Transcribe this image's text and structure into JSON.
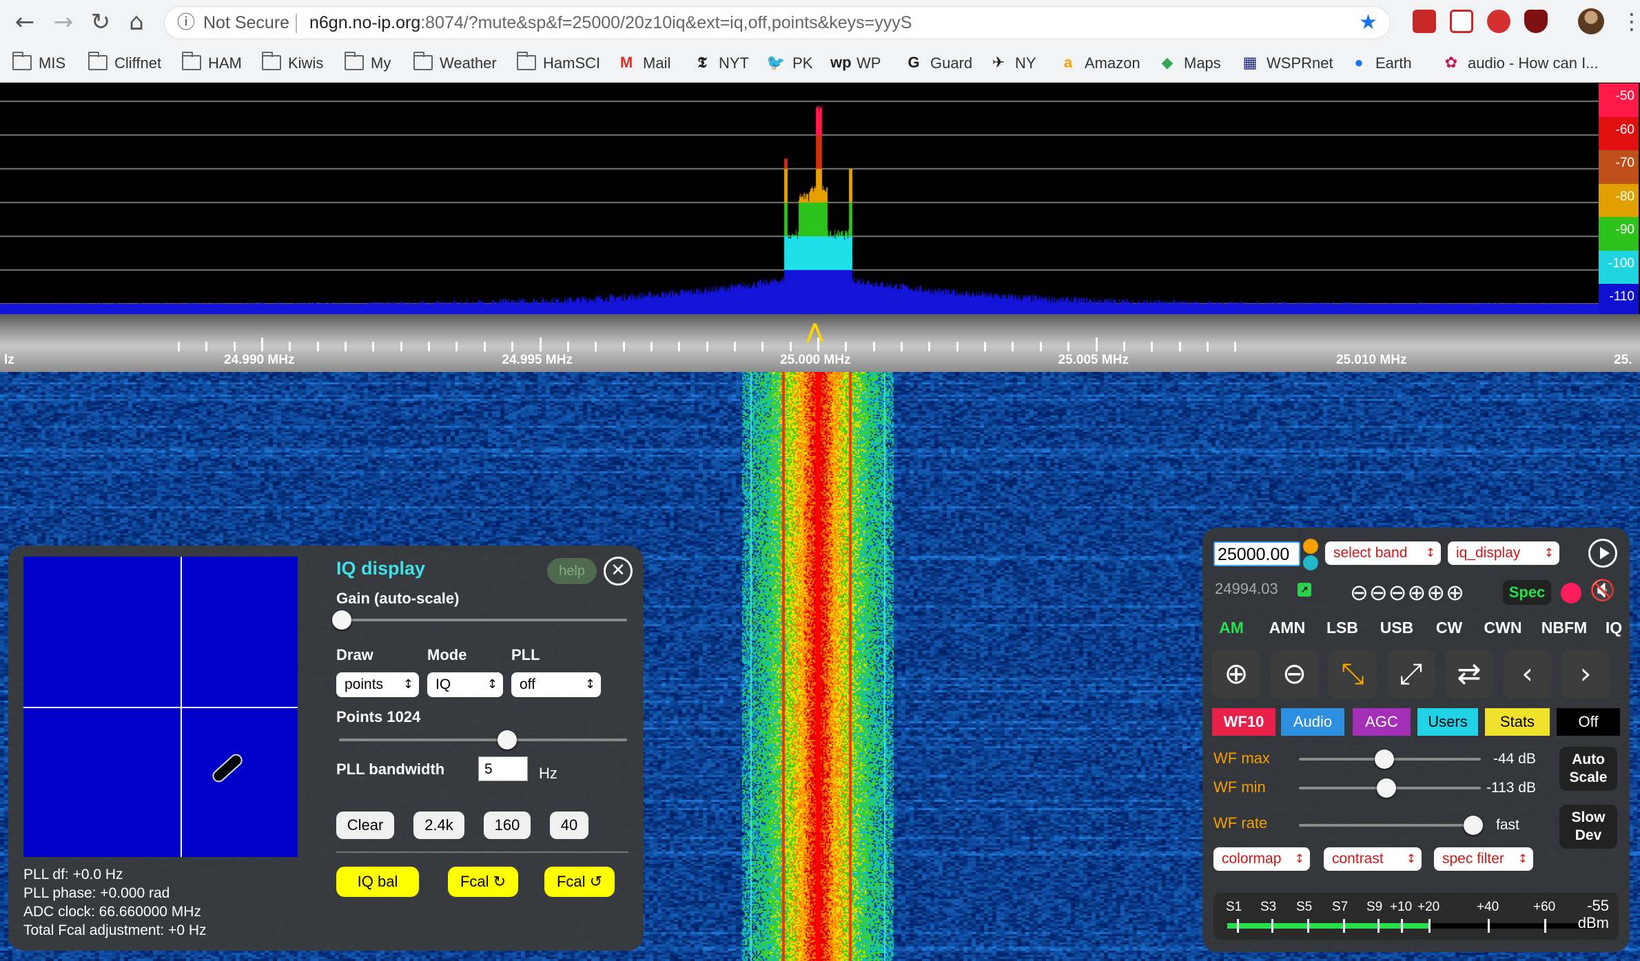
{
  "browser": {
    "back_glyph": "←",
    "forward_glyph": "→",
    "reload_glyph": "↻",
    "home_glyph": "⌂",
    "info_glyph": "ⓘ",
    "not_secure": "Not Secure",
    "url_host": "n6gn.no-ip.org",
    "url_rest": ":8074/?mute&sp&f=25000/20z10iq&ext=iq,off,points&keys=yyyS",
    "star_glyph": "★",
    "menu_glyph": "⋮",
    "bookmarks": [
      {
        "label": "MIS",
        "icon": "folder"
      },
      {
        "label": "Cliffnet",
        "icon": "folder"
      },
      {
        "label": "HAM",
        "icon": "folder"
      },
      {
        "label": "Kiwis",
        "icon": "folder"
      },
      {
        "label": "My",
        "icon": "folder"
      },
      {
        "label": "Weather",
        "icon": "folder"
      },
      {
        "label": "HamSCI",
        "icon": "folder"
      },
      {
        "label": "Mail",
        "icon": "M"
      },
      {
        "label": "NYT",
        "icon": "𝕿"
      },
      {
        "label": "PK",
        "icon": "🐦"
      },
      {
        "label": "WP",
        "icon": "wp"
      },
      {
        "label": "Guard",
        "icon": "G"
      },
      {
        "label": "NY",
        "icon": "✈"
      },
      {
        "label": "Amazon",
        "icon": "a"
      },
      {
        "label": "Maps",
        "icon": "◆"
      },
      {
        "label": "WSPRnet",
        "icon": "▦"
      },
      {
        "label": "Earth",
        "icon": "●"
      },
      {
        "label": "audio - How can I...",
        "icon": "✿"
      }
    ]
  },
  "spectrum": {
    "db_scale": [
      "-50",
      "-60",
      "-70",
      "-80",
      "-90",
      "-100",
      "-110"
    ],
    "scale_colors": [
      "#ff1a4a",
      "#e01010",
      "#c0501a",
      "#e0a000",
      "#2ec21c",
      "#1fd6e0",
      "#1010d0"
    ]
  },
  "ruler": {
    "labels": [
      {
        "text": "lz",
        "mhz": null
      },
      {
        "text": "24.990 MHz",
        "mhz": 24.99
      },
      {
        "text": "24.995 MHz",
        "mhz": 24.995
      },
      {
        "text": "25.000 MHz",
        "mhz": 25.0
      },
      {
        "text": "25.005 MHz",
        "mhz": 25.005
      },
      {
        "text": "25.010 MHz",
        "mhz": 25.01
      },
      {
        "text": "25.",
        "mhz": null
      }
    ],
    "marker_glyph": "⋀"
  },
  "iq": {
    "title": "IQ display",
    "help": "help",
    "close_glyph": "✕",
    "gain_label": "Gain (auto-scale)",
    "gain_level": 0.0,
    "draw_label": "Draw",
    "mode_label": "Mode",
    "pll_label": "PLL",
    "draw_value": "points",
    "mode_value": "IQ",
    "pll_value": "off",
    "points_label": "Points 1024",
    "points_level": 0.58,
    "pll_bw_label": "PLL bandwidth",
    "pll_bw_value": "5",
    "pll_bw_unit": "Hz",
    "buttons": [
      "Clear",
      "2.4k",
      "160",
      "40"
    ],
    "iq_bal": "IQ bal",
    "fcal_cw": "Fcal ↻",
    "fcal_ccw": "Fcal ↺",
    "info": [
      "PLL df: +0.0 Hz",
      "PLL phase: +0.000 rad",
      "ADC clock: 66.660000 MHz",
      "Total Fcal adjustment: +0 Hz"
    ]
  },
  "control": {
    "freq": "25000.00",
    "band_select": "select band",
    "ext_select": "iq_display",
    "sub_freq": "24994.03",
    "zoom_glyphs": "⊖⊖⊖⊕⊕⊕",
    "spec": "Spec",
    "mute_glyph": "🔇",
    "modes": [
      "AM",
      "AMN",
      "LSB",
      "USB",
      "CW",
      "CWN",
      "NBFM",
      "IQ"
    ],
    "active_mode": "AM",
    "icons": [
      {
        "name": "zoom-in-icon",
        "glyph": "⊕"
      },
      {
        "name": "zoom-out-icon",
        "glyph": "⊖"
      },
      {
        "name": "zoom-to-band-icon",
        "glyph": "⤡"
      },
      {
        "name": "zoom-max-icon",
        "glyph": "⤢"
      },
      {
        "name": "swap-icon",
        "glyph": "⇄"
      },
      {
        "name": "page-left-icon",
        "glyph": "‹"
      },
      {
        "name": "page-right-icon",
        "glyph": "›"
      }
    ],
    "tabs": [
      {
        "label": "WF10",
        "bg": "#e8204a",
        "fg": "#ffffff"
      },
      {
        "label": "Audio",
        "bg": "#2d8fe0",
        "fg": "#ffffff"
      },
      {
        "label": "AGC",
        "bg": "#a430b8",
        "fg": "#ffffff"
      },
      {
        "label": "Users",
        "bg": "#1fd2e6",
        "fg": "#000000"
      },
      {
        "label": "Stats",
        "bg": "#f0e22c",
        "fg": "#000000"
      },
      {
        "label": "Off",
        "bg": "#000000",
        "fg": "#ffffff"
      }
    ],
    "wf_max_label": "WF max",
    "wf_max_value": "-44 dB",
    "wf_max_level": 0.47,
    "wf_min_label": "WF min",
    "wf_min_value": "-113 dB",
    "wf_min_level": 0.48,
    "wf_rate_label": "WF rate",
    "wf_rate_value": "fast",
    "wf_rate_level": 0.96,
    "auto_scale": "Auto Scale",
    "slow_dev": "Slow Dev",
    "colormap": "colormap",
    "contrast": "contrast",
    "spec_filter": "spec filter",
    "smeter_labels": [
      "S1",
      "S3",
      "S5",
      "S7",
      "S9",
      "+10",
      "+20",
      "+40",
      "+60"
    ],
    "smeter_level": 0.54,
    "dbm_value": "-55",
    "dbm_unit": "dBm"
  }
}
